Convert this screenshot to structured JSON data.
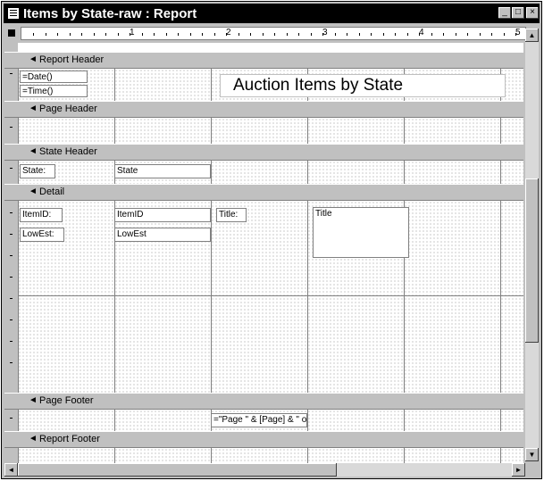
{
  "window": {
    "title": "Items by State-raw : Report",
    "minimize": "_",
    "maximize": "□",
    "close": "×"
  },
  "ruler": {
    "numbers": [
      "1",
      "2",
      "3",
      "4",
      "5"
    ]
  },
  "sections": {
    "report_header": "Report Header",
    "page_header": "Page Header",
    "state_header": "State Header",
    "detail": "Detail",
    "page_footer": "Page Footer",
    "report_footer": "Report Footer"
  },
  "controls": {
    "date_field": "=Date()",
    "time_field": "=Time()",
    "report_title": "Auction Items by State",
    "state_label": "State:",
    "state_field": "State",
    "itemid_label": "ItemID:",
    "itemid_field": "ItemID",
    "title_label": "Title:",
    "title_field": "Title",
    "lowest_label": "LowEst:",
    "lowest_field": "LowEst",
    "page_expr": "=\"Page \" & [Page] & \" of \" & [Pages]"
  },
  "icons": {
    "section_arrow": "section-arrow-icon",
    "scroll_up": "▲",
    "scroll_down": "▼",
    "scroll_left": "◄",
    "scroll_right": "►"
  },
  "colors": {
    "titlebar": "#000000",
    "chrome": "#c0c0c0",
    "canvas": "#ffffff"
  }
}
